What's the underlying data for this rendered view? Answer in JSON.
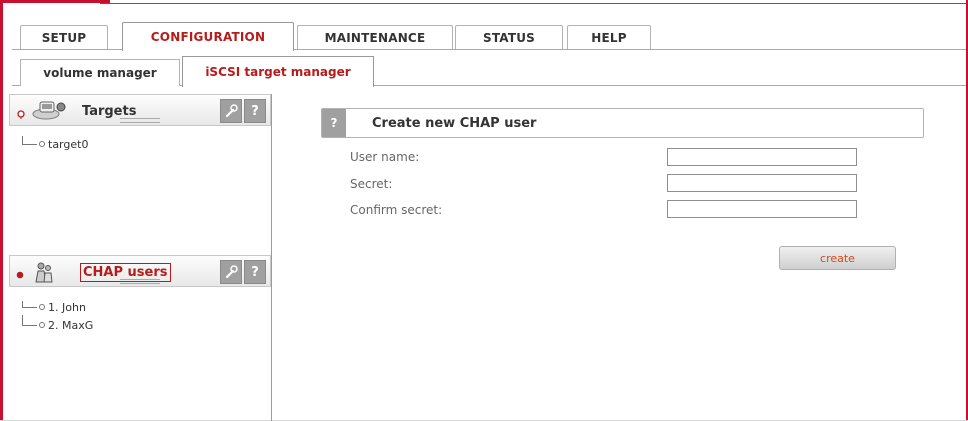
{
  "main_tabs": [
    "SETUP",
    "CONFIGURATION",
    "MAINTENANCE",
    "STATUS",
    "HELP"
  ],
  "active_main_tab": "CONFIGURATION",
  "sub_tabs": [
    "volume manager",
    "iSCSI target manager"
  ],
  "active_sub_tab": "iSCSI target manager",
  "left_panel": {
    "targets": {
      "title": "Targets",
      "items": [
        "target0"
      ],
      "wrench": "wrench-icon",
      "help": "?"
    },
    "chap_users": {
      "title": "CHAP users",
      "items": [
        "1. John",
        "2. MaxG"
      ],
      "wrench": "wrench-icon",
      "help": "?"
    }
  },
  "form": {
    "help": "?",
    "title": "Create new CHAP user",
    "fields": [
      {
        "label": "User name:",
        "value": ""
      },
      {
        "label": "Secret:",
        "value": ""
      },
      {
        "label": "Confirm secret:",
        "value": ""
      }
    ],
    "create_label": "create"
  },
  "colors": {
    "accent": "#c8102e",
    "active_tab_text": "#b71c1c",
    "button_text": "#d24a1a"
  }
}
